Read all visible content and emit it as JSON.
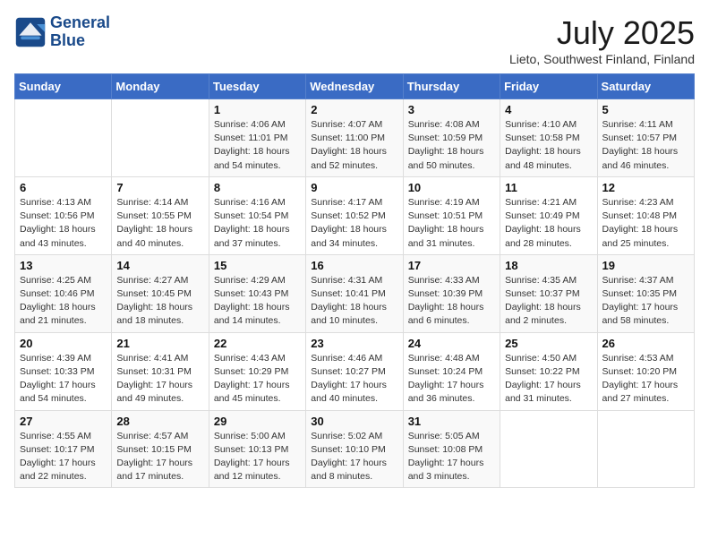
{
  "logo": {
    "line1": "General",
    "line2": "Blue"
  },
  "title": "July 2025",
  "location": "Lieto, Southwest Finland, Finland",
  "days_of_week": [
    "Sunday",
    "Monday",
    "Tuesday",
    "Wednesday",
    "Thursday",
    "Friday",
    "Saturday"
  ],
  "weeks": [
    [
      {
        "day": "",
        "content": ""
      },
      {
        "day": "",
        "content": ""
      },
      {
        "day": "1",
        "content": "Sunrise: 4:06 AM\nSunset: 11:01 PM\nDaylight: 18 hours and 54 minutes."
      },
      {
        "day": "2",
        "content": "Sunrise: 4:07 AM\nSunset: 11:00 PM\nDaylight: 18 hours and 52 minutes."
      },
      {
        "day": "3",
        "content": "Sunrise: 4:08 AM\nSunset: 10:59 PM\nDaylight: 18 hours and 50 minutes."
      },
      {
        "day": "4",
        "content": "Sunrise: 4:10 AM\nSunset: 10:58 PM\nDaylight: 18 hours and 48 minutes."
      },
      {
        "day": "5",
        "content": "Sunrise: 4:11 AM\nSunset: 10:57 PM\nDaylight: 18 hours and 46 minutes."
      }
    ],
    [
      {
        "day": "6",
        "content": "Sunrise: 4:13 AM\nSunset: 10:56 PM\nDaylight: 18 hours and 43 minutes."
      },
      {
        "day": "7",
        "content": "Sunrise: 4:14 AM\nSunset: 10:55 PM\nDaylight: 18 hours and 40 minutes."
      },
      {
        "day": "8",
        "content": "Sunrise: 4:16 AM\nSunset: 10:54 PM\nDaylight: 18 hours and 37 minutes."
      },
      {
        "day": "9",
        "content": "Sunrise: 4:17 AM\nSunset: 10:52 PM\nDaylight: 18 hours and 34 minutes."
      },
      {
        "day": "10",
        "content": "Sunrise: 4:19 AM\nSunset: 10:51 PM\nDaylight: 18 hours and 31 minutes."
      },
      {
        "day": "11",
        "content": "Sunrise: 4:21 AM\nSunset: 10:49 PM\nDaylight: 18 hours and 28 minutes."
      },
      {
        "day": "12",
        "content": "Sunrise: 4:23 AM\nSunset: 10:48 PM\nDaylight: 18 hours and 25 minutes."
      }
    ],
    [
      {
        "day": "13",
        "content": "Sunrise: 4:25 AM\nSunset: 10:46 PM\nDaylight: 18 hours and 21 minutes."
      },
      {
        "day": "14",
        "content": "Sunrise: 4:27 AM\nSunset: 10:45 PM\nDaylight: 18 hours and 18 minutes."
      },
      {
        "day": "15",
        "content": "Sunrise: 4:29 AM\nSunset: 10:43 PM\nDaylight: 18 hours and 14 minutes."
      },
      {
        "day": "16",
        "content": "Sunrise: 4:31 AM\nSunset: 10:41 PM\nDaylight: 18 hours and 10 minutes."
      },
      {
        "day": "17",
        "content": "Sunrise: 4:33 AM\nSunset: 10:39 PM\nDaylight: 18 hours and 6 minutes."
      },
      {
        "day": "18",
        "content": "Sunrise: 4:35 AM\nSunset: 10:37 PM\nDaylight: 18 hours and 2 minutes."
      },
      {
        "day": "19",
        "content": "Sunrise: 4:37 AM\nSunset: 10:35 PM\nDaylight: 17 hours and 58 minutes."
      }
    ],
    [
      {
        "day": "20",
        "content": "Sunrise: 4:39 AM\nSunset: 10:33 PM\nDaylight: 17 hours and 54 minutes."
      },
      {
        "day": "21",
        "content": "Sunrise: 4:41 AM\nSunset: 10:31 PM\nDaylight: 17 hours and 49 minutes."
      },
      {
        "day": "22",
        "content": "Sunrise: 4:43 AM\nSunset: 10:29 PM\nDaylight: 17 hours and 45 minutes."
      },
      {
        "day": "23",
        "content": "Sunrise: 4:46 AM\nSunset: 10:27 PM\nDaylight: 17 hours and 40 minutes."
      },
      {
        "day": "24",
        "content": "Sunrise: 4:48 AM\nSunset: 10:24 PM\nDaylight: 17 hours and 36 minutes."
      },
      {
        "day": "25",
        "content": "Sunrise: 4:50 AM\nSunset: 10:22 PM\nDaylight: 17 hours and 31 minutes."
      },
      {
        "day": "26",
        "content": "Sunrise: 4:53 AM\nSunset: 10:20 PM\nDaylight: 17 hours and 27 minutes."
      }
    ],
    [
      {
        "day": "27",
        "content": "Sunrise: 4:55 AM\nSunset: 10:17 PM\nDaylight: 17 hours and 22 minutes."
      },
      {
        "day": "28",
        "content": "Sunrise: 4:57 AM\nSunset: 10:15 PM\nDaylight: 17 hours and 17 minutes."
      },
      {
        "day": "29",
        "content": "Sunrise: 5:00 AM\nSunset: 10:13 PM\nDaylight: 17 hours and 12 minutes."
      },
      {
        "day": "30",
        "content": "Sunrise: 5:02 AM\nSunset: 10:10 PM\nDaylight: 17 hours and 8 minutes."
      },
      {
        "day": "31",
        "content": "Sunrise: 5:05 AM\nSunset: 10:08 PM\nDaylight: 17 hours and 3 minutes."
      },
      {
        "day": "",
        "content": ""
      },
      {
        "day": "",
        "content": ""
      }
    ]
  ]
}
